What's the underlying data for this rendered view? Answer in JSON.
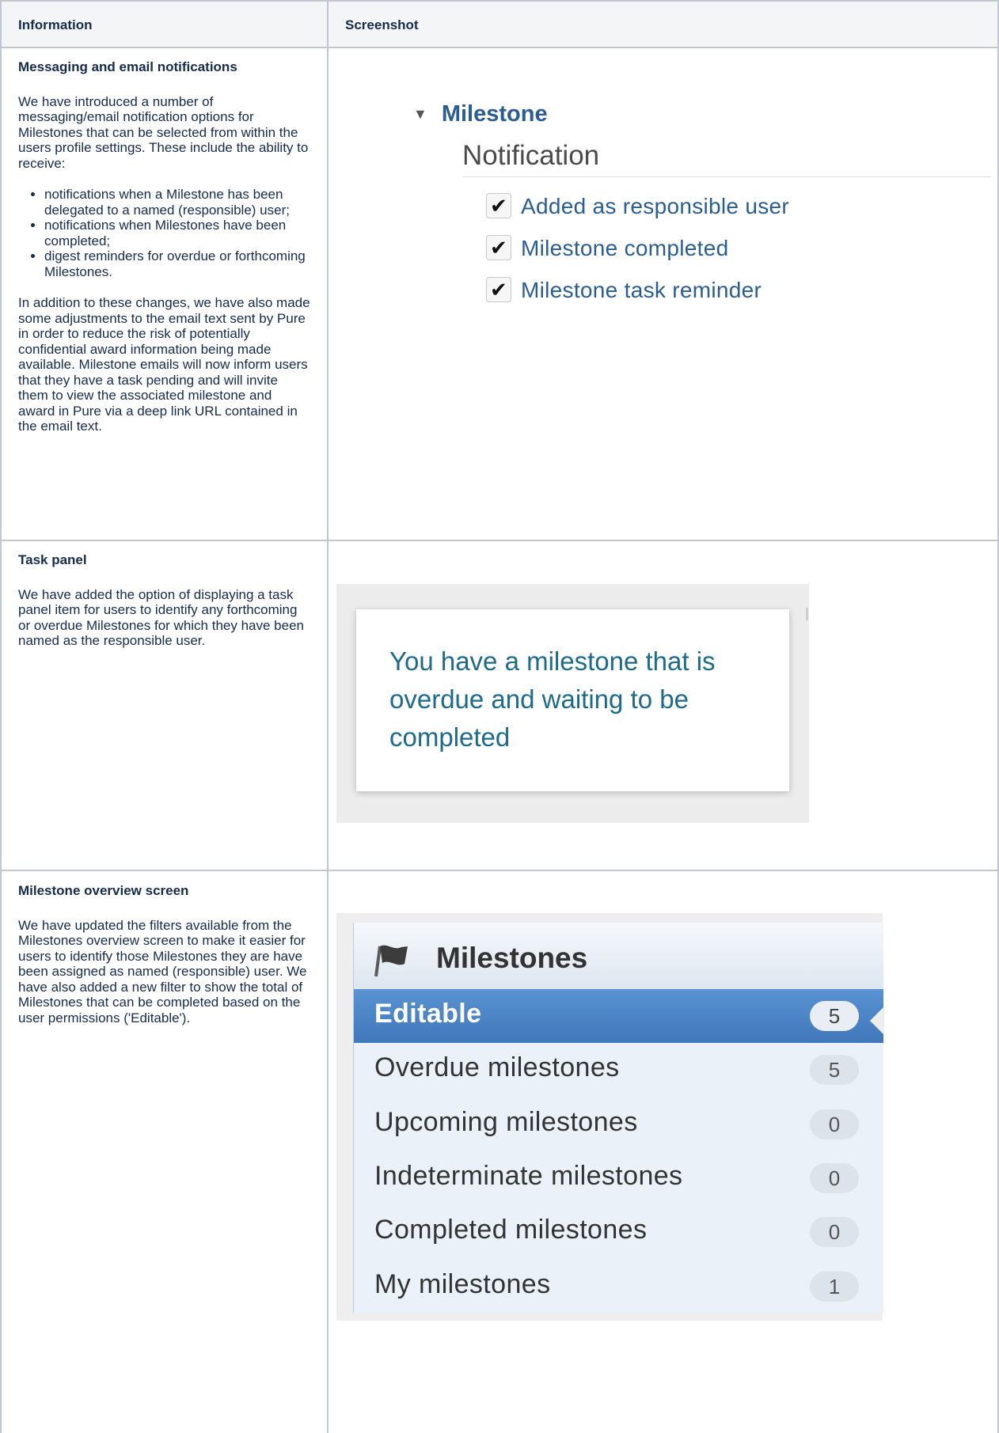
{
  "table": {
    "headers": {
      "information": "Information",
      "screenshot": "Screenshot"
    },
    "rows": [
      {
        "title": "Messaging and email notifications",
        "intro": "We have introduced a number of messaging/email notification options for Milestones that can be selected from within the users profile settings. These include the ability to receive:",
        "bullets": [
          "notifications when a Milestone has been delegated to a named (responsible) user;",
          "notifications when Milestones have been completed;",
          "digest reminders for overdue or forthcoming Milestones."
        ],
        "outro": "In addition to these changes, we have also made some adjustments to the email text sent by Pure in order to reduce the risk of potentially confidential award information being made available.  Milestone emails will now inform users that they have a task pending and will invite them to view the associated milestone and award in Pure via a deep link URL contained in the email text."
      },
      {
        "title": "Task panel",
        "body": "We have added the option of displaying a task panel item for users to identify any forthcoming or overdue Milestones for which they have been named as the responsible user."
      },
      {
        "title": "Milestone overview screen",
        "body": "We have updated the filters available from the Milestones overview screen to make it easier for users to identify those Milestones they are have been assigned as named (responsible) user.  We have also added a new filter to show the total of Milestones that can be completed based on the user permissions ('Editable')."
      }
    ]
  },
  "notifications": {
    "section_label": "Milestone",
    "heading": "Notification",
    "options": [
      {
        "label": "Added as responsible user",
        "checked": true
      },
      {
        "label": "Milestone completed",
        "checked": true
      },
      {
        "label": "Milestone task reminder",
        "checked": true
      }
    ],
    "icons": {
      "toggle": "triangle-down-icon",
      "check": "checkmark-icon"
    }
  },
  "task_panel": {
    "message": "You have a milestone that is overdue and waiting to be completed"
  },
  "milestones_filter": {
    "title": "Milestones",
    "icon": "flag-icon",
    "items": [
      {
        "label": "Editable",
        "count": "5",
        "active": true
      },
      {
        "label": "Overdue milestones",
        "count": "5",
        "active": false
      },
      {
        "label": "Upcoming milestones",
        "count": "0",
        "active": false
      },
      {
        "label": "Indeterminate milestones",
        "count": "0",
        "active": false
      },
      {
        "label": "Completed milestones",
        "count": "0",
        "active": false
      },
      {
        "label": "My milestones",
        "count": "1",
        "active": false
      }
    ],
    "colors": {
      "active": "#4a86c8",
      "panel": "#eaf1f8"
    }
  }
}
